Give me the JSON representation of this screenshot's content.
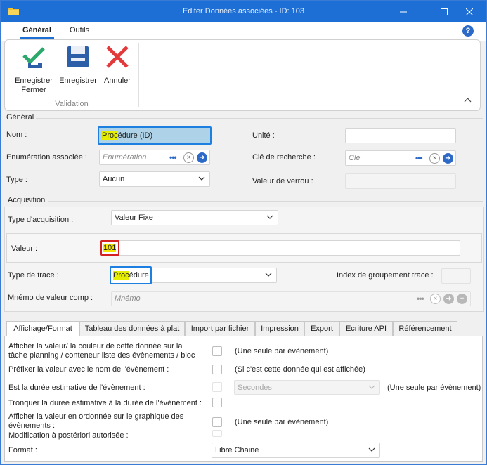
{
  "window": {
    "title": "Editer Données associées - ID: 103",
    "minimize_icon": "minimize-icon",
    "maximize_icon": "maximize-icon",
    "close_icon": "close-icon"
  },
  "ribbon": {
    "tabs": [
      {
        "label": "Général",
        "active": true
      },
      {
        "label": "Outils",
        "active": false
      }
    ],
    "help_label": "?",
    "buttons": [
      {
        "label_line1": "Enregistrer",
        "label_line2": "Fermer",
        "icon": "save-close-icon"
      },
      {
        "label_line1": "Enregistrer",
        "label_line2": "",
        "icon": "save-icon"
      },
      {
        "label_line1": "Annuler",
        "label_line2": "",
        "icon": "cancel-icon"
      }
    ],
    "group_label": "Validation"
  },
  "general": {
    "title": "Général",
    "nom_label": "Nom :",
    "nom_value_hl": "Proc",
    "nom_value_rest": "édure (ID)",
    "unite_label": "Unité :",
    "unite_value": "",
    "enum_label": "Enumération associée :",
    "enum_placeholder": "Enumération",
    "cle_label": "Clé de recherche :",
    "cle_placeholder": "Clé",
    "type_label": "Type :",
    "type_value": "Aucun",
    "verrou_label": "Valeur de verrou :"
  },
  "acquisition": {
    "title": "Acquisition",
    "type_acq_label": "Type d'acquisition :",
    "type_acq_value": "Valeur Fixe",
    "valeur_label": "Valeur :",
    "valeur_value": "101",
    "trace_label": "Type de trace :",
    "trace_value_hl": "Proc",
    "trace_value_rest": "édure",
    "index_label": "Index de groupement trace :",
    "mnemo_label": "Mnémo de valeur comp :",
    "mnemo_placeholder": "Mnémo"
  },
  "tabs": [
    {
      "label": "Affichage/Format",
      "active": true
    },
    {
      "label": "Tableau des données à plat",
      "active": false
    },
    {
      "label": "Import par fichier",
      "active": false
    },
    {
      "label": "Impression",
      "active": false
    },
    {
      "label": "Export",
      "active": false
    },
    {
      "label": "Ecriture API",
      "active": false
    },
    {
      "label": "Référencement",
      "active": false
    }
  ],
  "affichage": {
    "row1_line1": "Afficher la valeur/ la couleur de cette donnée sur la",
    "row1_line2": "tâche planning / conteneur liste des évènements / bloc",
    "row1_note": "(Une seule par évènement)",
    "row2_label": "Préfixer la valeur avec le nom de l'évènement :",
    "row2_note": "(Si c'est cette donnée qui est affichée)",
    "row3_label": "Est la durée estimative de l'évènement :",
    "row3_select": "Secondes",
    "row3_note": "(Une seule par évènement)",
    "row4_label": "Tronquer la durée estimative à la durée de l'évènement :",
    "row5_line1": "Afficher la valeur en ordonnée sur le graphique des",
    "row5_line2": "évènements :",
    "row5_note": "(Une seule par évènement)",
    "row6_label": "Modification à postériori autorisée :",
    "format_label": "Format :",
    "format_value": "Libre Chaine"
  }
}
